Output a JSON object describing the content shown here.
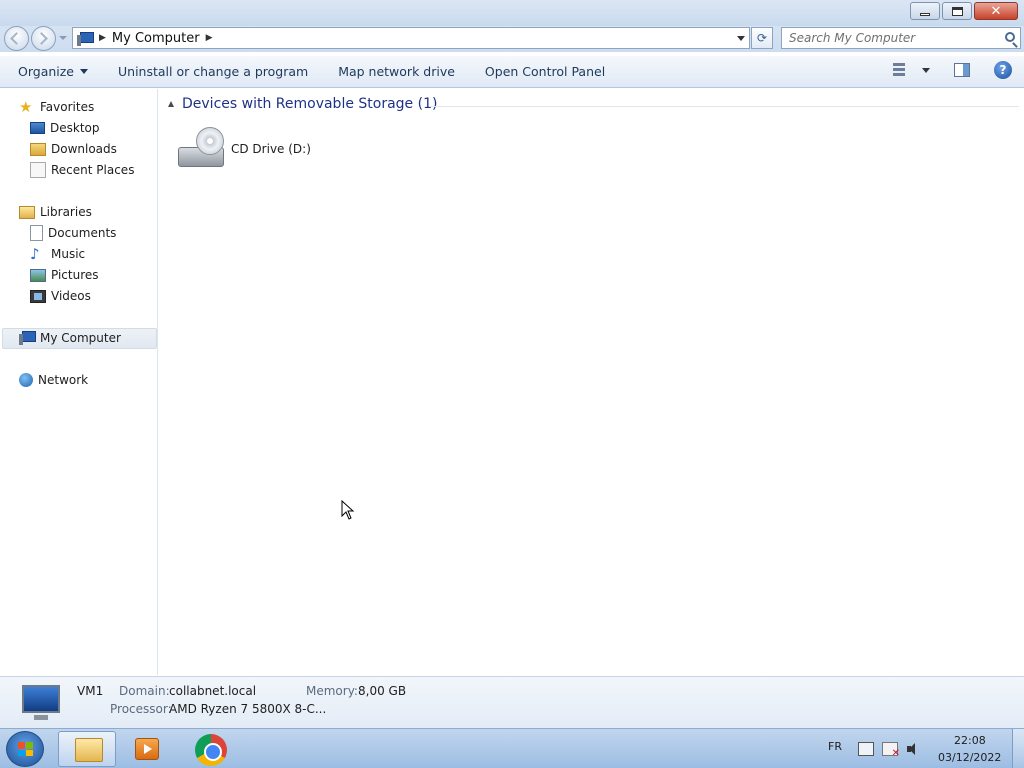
{
  "window": {
    "controls": {
      "minimize": "minimize",
      "maximize": "restore",
      "close": "close"
    }
  },
  "address": {
    "path": "My Computer",
    "search_placeholder": "Search My Computer"
  },
  "toolbar": {
    "organize": "Organize",
    "uninstall": "Uninstall or change a program",
    "map_drive": "Map network drive",
    "control_panel": "Open Control Panel"
  },
  "nav": {
    "favorites": "Favorites",
    "desktop": "Desktop",
    "downloads": "Downloads",
    "recent": "Recent Places",
    "libraries": "Libraries",
    "documents": "Documents",
    "music": "Music",
    "pictures": "Pictures",
    "videos": "Videos",
    "computer": "My Computer",
    "network": "Network"
  },
  "content": {
    "group_title": "Devices with Removable Storage (1)",
    "drive_label": "CD Drive (D:)"
  },
  "details": {
    "name": "VM1",
    "domain_label": "Domain:",
    "domain_value": "collabnet.local",
    "memory_label": "Memory:",
    "memory_value": "8,00 GB",
    "processor_label": "Processor:",
    "processor_value": "AMD Ryzen 7 5800X 8-C..."
  },
  "taskbar": {
    "language": "FR",
    "time": "22:08",
    "date": "03/12/2022"
  },
  "colors": {
    "accent": "#1e3287",
    "command_text": "#1e395b",
    "selection": "#e1e8f1",
    "taskbar": "#9cbde3"
  }
}
